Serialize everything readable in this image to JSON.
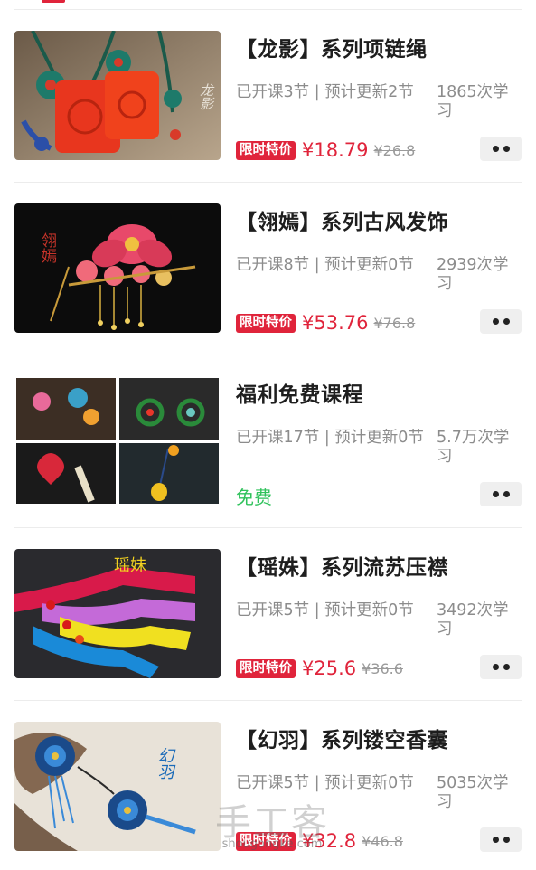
{
  "courses": [
    {
      "title": "【龙影】系列项链绳",
      "lessons": "已开课3节 | 预计更新2节",
      "views": "1865次学习",
      "badge": "限时特价",
      "price": "¥18.79",
      "original_price": "¥26.8",
      "thumb_text": "龙影"
    },
    {
      "title": "【翎嫣】系列古风发饰",
      "lessons": "已开课8节 | 预计更新0节",
      "views": "2939次学习",
      "badge": "限时特价",
      "price": "¥53.76",
      "original_price": "¥76.8",
      "thumb_text": "翎嫣"
    },
    {
      "title": "福利免费课程",
      "lessons": "已开课17节 | 预计更新0节",
      "views": "5.7万次学习",
      "free_label": "免费"
    },
    {
      "title": "【瑶姝】系列流苏压襟",
      "lessons": "已开课5节 | 预计更新0节",
      "views": "3492次学习",
      "badge": "限时特价",
      "price": "¥25.6",
      "original_price": "¥36.6",
      "thumb_text": "瑶妹"
    },
    {
      "title": "【幻羽】系列镂空香囊",
      "lessons": "已开课5节 | 预计更新0节",
      "views": "5035次学习",
      "badge": "限时特价",
      "price": "¥32.8",
      "original_price": "¥46.8",
      "thumb_text": "幻羽"
    }
  ],
  "watermark": {
    "brand": "手工客",
    "url": "shougongke.com"
  },
  "colors": {
    "accent_red": "#e0243b",
    "free_green": "#2fc25b",
    "meta_gray": "#8c8c8c"
  }
}
